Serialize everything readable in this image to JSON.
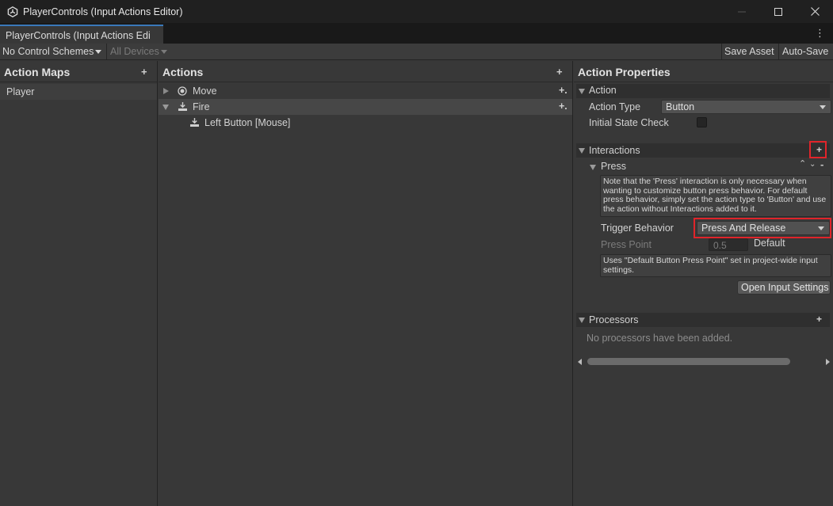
{
  "window": {
    "title": "PlayerControls (Input Actions Editor)",
    "tab_label": "PlayerControls (Input Actions Edi"
  },
  "toolbar": {
    "control_schemes": "No Control Schemes",
    "devices": "All Devices",
    "save_asset": "Save Asset",
    "auto_save": "Auto-Save"
  },
  "action_maps": {
    "header": "Action Maps",
    "items": [
      {
        "label": "Player"
      }
    ]
  },
  "actions": {
    "header": "Actions",
    "items": [
      {
        "label": "Move"
      },
      {
        "label": "Fire"
      },
      {
        "label": "Left Button [Mouse]"
      }
    ]
  },
  "properties": {
    "header": "Action Properties",
    "action_section": "Action",
    "action_type_label": "Action Type",
    "action_type_value": "Button",
    "initial_state_label": "Initial State Check",
    "interactions_section": "Interactions",
    "press_label": "Press",
    "press_note": "Note that the 'Press' interaction is only necessary when wanting to customize button press behavior. For default press behavior, simply set the action type to 'Button' and use the action without Interactions added to it.",
    "trigger_behavior_label": "Trigger Behavior",
    "trigger_behavior_value": "Press And Release",
    "press_point_label": "Press Point",
    "press_point_value": "0.5",
    "press_point_default": "Default",
    "press_point_note": "Uses \"Default Button Press Point\" set in project-wide input settings.",
    "open_settings": "Open Input Settings",
    "processors_section": "Processors",
    "no_processors": "No processors have been added."
  },
  "colors": {
    "accent": "#3a79bb",
    "highlight": "#e0242a"
  }
}
